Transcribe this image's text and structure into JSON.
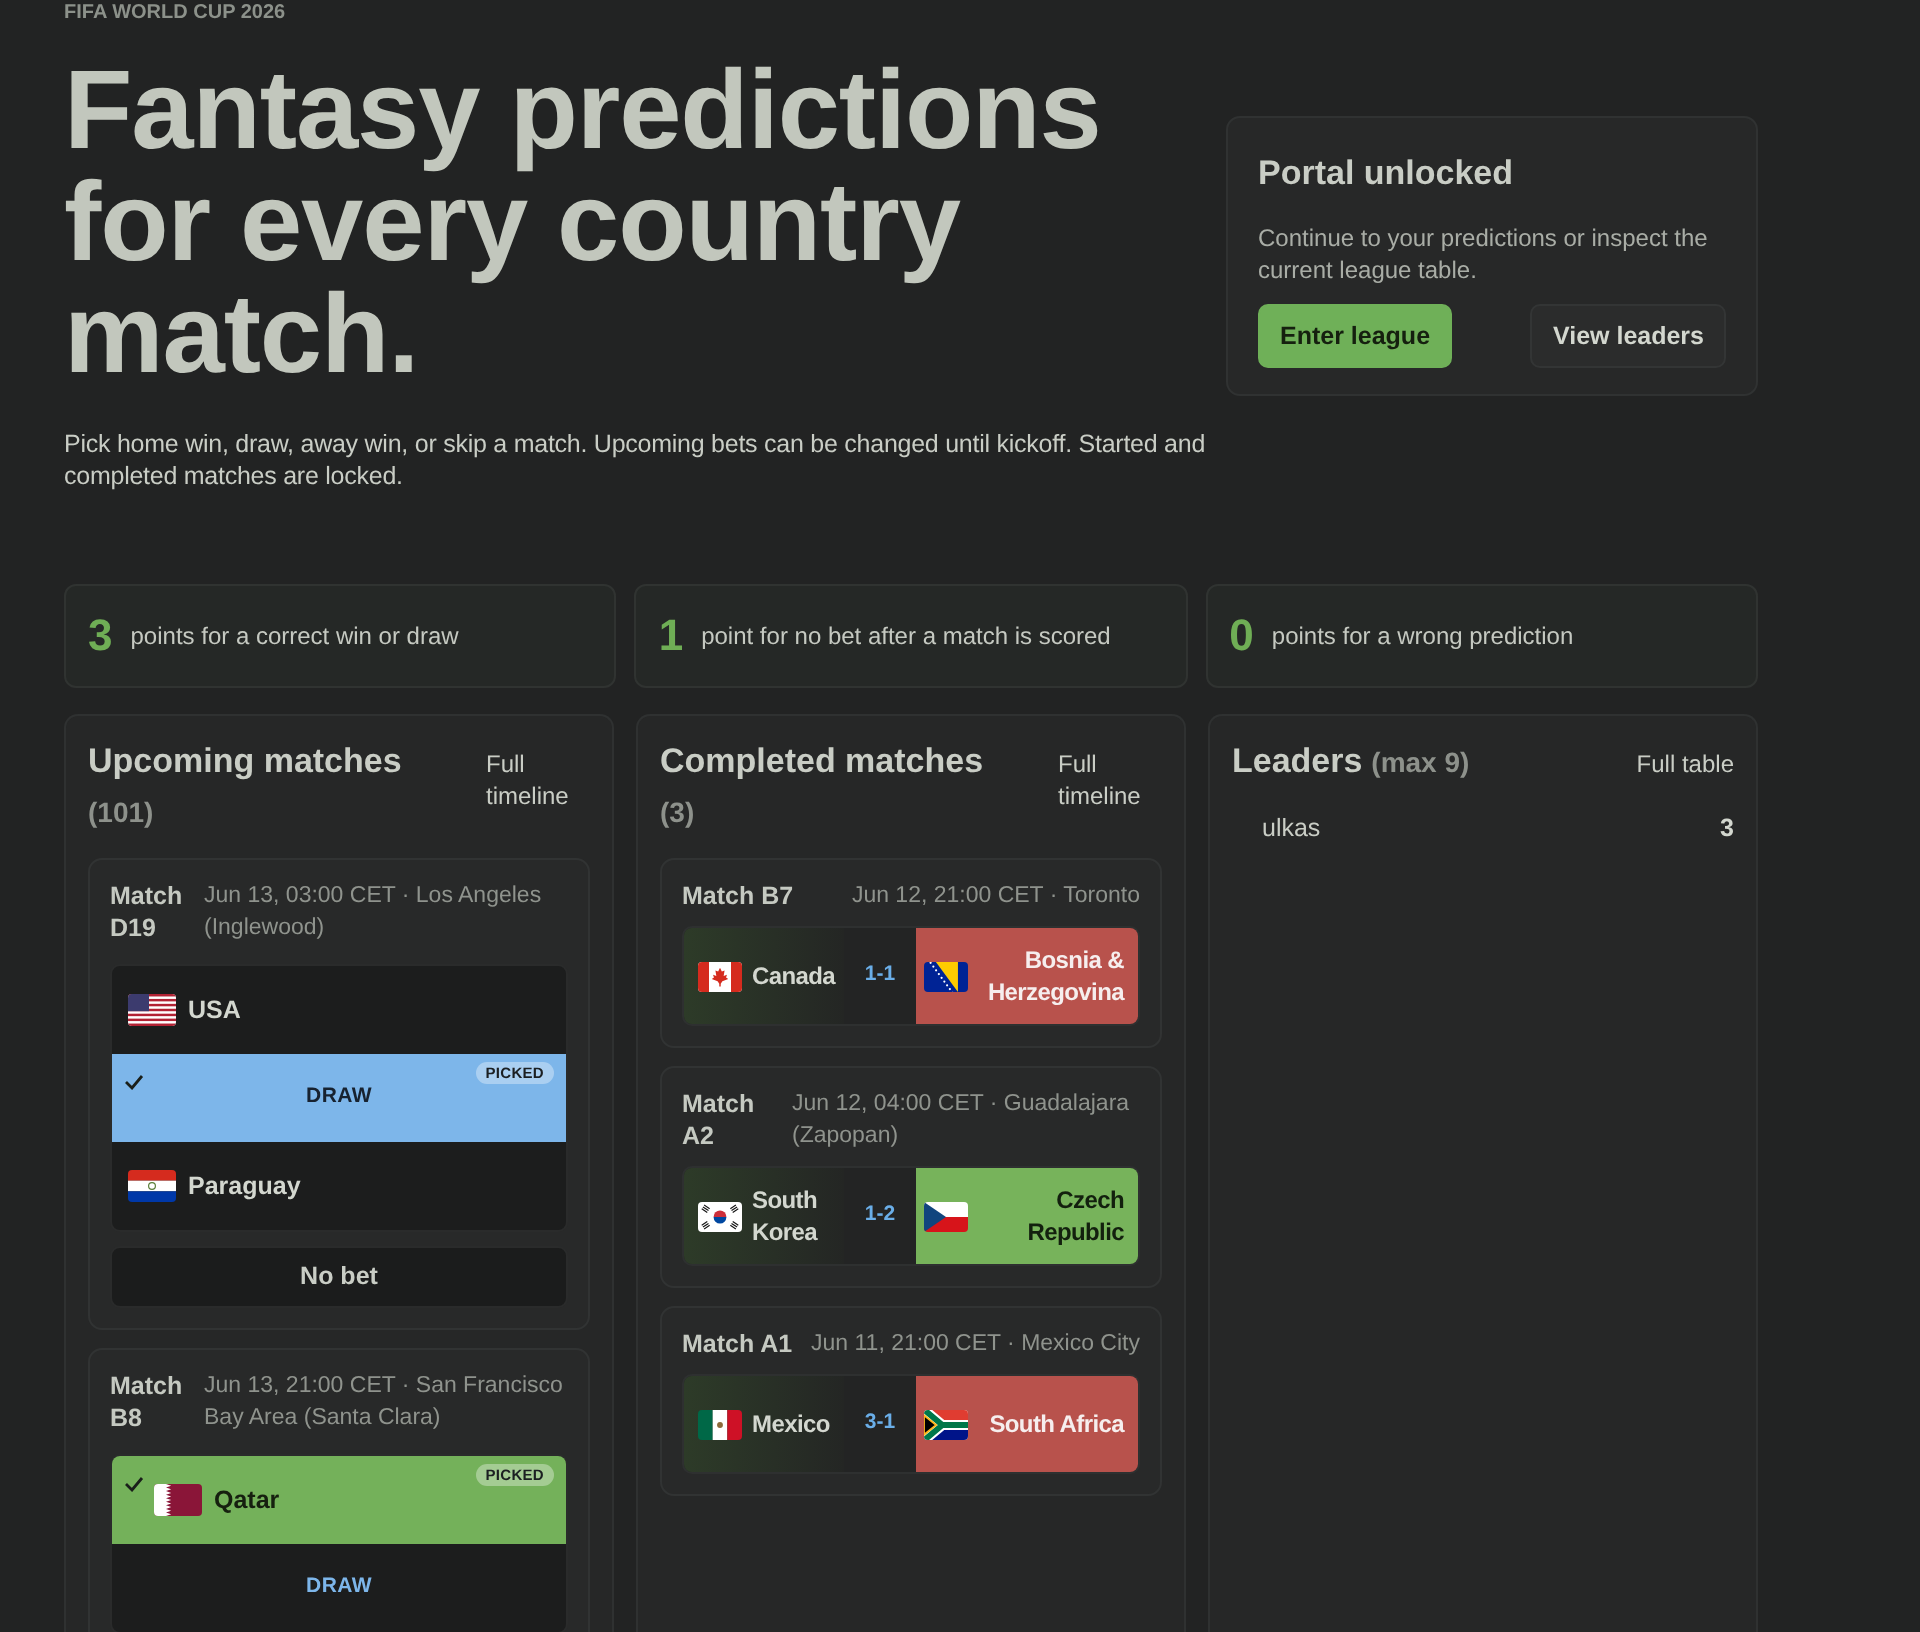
{
  "header": {
    "eyebrow": "FIFA WORLD CUP 2026",
    "title": "Fantasy predictions for every country match.",
    "description": "Pick home win, draw, away win, or skip a match. Upcoming bets can be changed until kickoff. Started and completed matches are locked."
  },
  "portal_card": {
    "title": "Portal unlocked",
    "text": "Continue to your predictions or inspect the current league table.",
    "buttons": [
      {
        "label": "Enter league",
        "kind": "primary"
      },
      {
        "label": "View leaders",
        "kind": "secondary"
      }
    ]
  },
  "scoring": [
    {
      "points": "3",
      "text": "points for a correct win or draw"
    },
    {
      "points": "1",
      "text": "point for no bet after a match is scored"
    },
    {
      "points": "0",
      "text": "points for a wrong prediction"
    }
  ],
  "upcoming": {
    "title": "Upcoming matches",
    "count": "(101)",
    "link": "Full timeline",
    "matches": [
      {
        "label": "Match D19",
        "info": "Jun 13, 03:00 CET · Los Angeles (Inglewood)",
        "options": [
          {
            "kind": "team",
            "label": "USA",
            "selected": false
          },
          {
            "kind": "draw",
            "label": "DRAW",
            "selected": true,
            "badge": "PICKED"
          },
          {
            "kind": "team",
            "label": "Paraguay",
            "selected": false
          }
        ],
        "no_bet": {
          "label": "No bet",
          "selected": false
        }
      },
      {
        "label": "Match B8",
        "info": "Jun 13, 21:00 CET · San Francisco Bay Area (Santa Clara)",
        "options": [
          {
            "kind": "team",
            "label": "Qatar",
            "selected": true,
            "badge": "PICKED"
          },
          {
            "kind": "draw",
            "label": "DRAW",
            "selected": false
          }
        ]
      }
    ]
  },
  "completed": {
    "title": "Completed matches",
    "count": "(3)",
    "link": "Full timeline",
    "matches": [
      {
        "label": "Match B7",
        "info": "Jun 12, 21:00 CET · Toronto",
        "home": {
          "name": "Canada",
          "selected": false
        },
        "score": "1-1",
        "away": {
          "name": "Bosnia & Herzegovina",
          "selected": true,
          "correct": false
        }
      },
      {
        "label": "Match A2",
        "info": "Jun 12, 04:00 CET · Guadalajara (Zapopan)",
        "home": {
          "name": "South Korea",
          "selected": false
        },
        "score": "1-2",
        "away": {
          "name": "Czech Republic",
          "selected": true,
          "correct": true
        }
      },
      {
        "label": "Match A1",
        "info": "Jun 11, 21:00 CET · Mexico City",
        "home": {
          "name": "Mexico",
          "selected": false
        },
        "score": "3-1",
        "away": {
          "name": "South Africa",
          "selected": true,
          "correct": false
        }
      }
    ]
  },
  "leaders": {
    "title": "Leaders",
    "limit": "(max 9)",
    "link": "Full table",
    "rows": [
      {
        "name": "ulkas",
        "points": "3"
      }
    ]
  }
}
